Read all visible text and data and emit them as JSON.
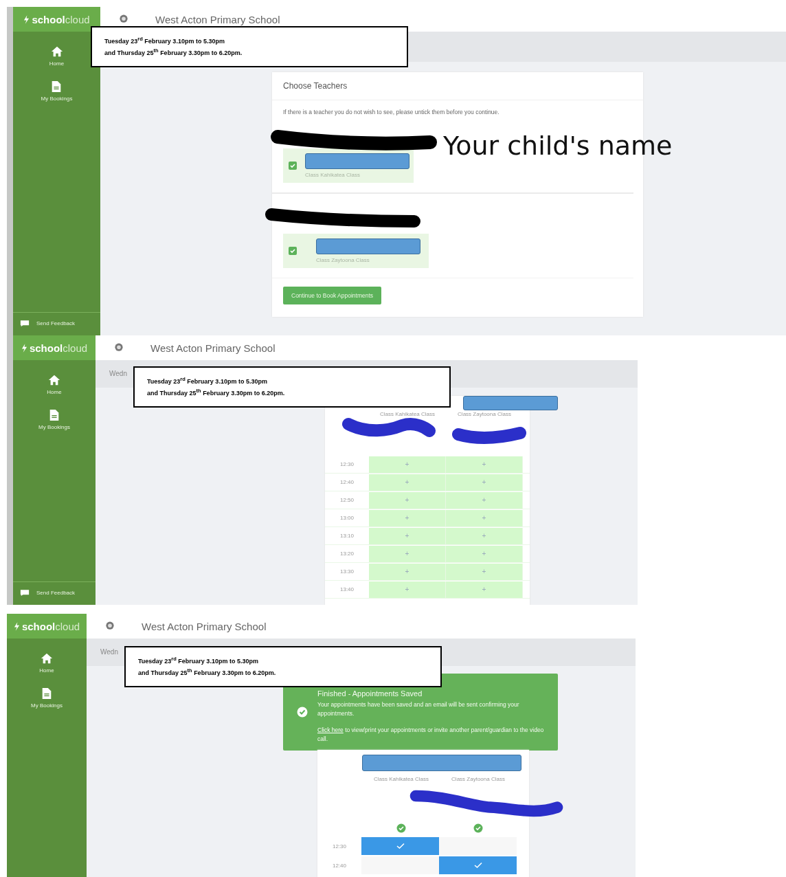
{
  "panels": [
    {
      "kind": "choose_teachers",
      "brand": {
        "bold": "school",
        "light": "cloud"
      },
      "school_name": "West Acton Primary School",
      "nav": [
        {
          "kind": "home",
          "label": "Home"
        },
        {
          "kind": "bookings",
          "label": "My Bookings"
        }
      ],
      "feedback": "Send Feedback",
      "note": [
        "Tuesday 23$^{rd}$ February 3.10pm to 5.30pm",
        "and Thursday 25$^{th}$ February 3.30pm to 6.20pm."
      ],
      "annotation": "Your child's name",
      "card": {
        "title": "Choose Teachers",
        "instruction": "If there is a teacher you do not wish to see, please untick them before you continue.",
        "teachers": [
          {
            "class": "Class Kahikatea Class",
            "checked": true
          },
          {
            "class": "Class Zaytoona Class",
            "checked": true
          }
        ],
        "button": "Continue to Book Appointments"
      }
    },
    {
      "kind": "slots",
      "brand": {
        "bold": "school",
        "light": "cloud"
      },
      "school_name": "West Acton Primary School",
      "nav": [
        {
          "kind": "home",
          "label": "Home"
        },
        {
          "kind": "bookings",
          "label": "My Bookings"
        }
      ],
      "feedback": "Send Feedback",
      "date_tab": "Wedn",
      "note": [
        "Tuesday 23$^{rd}$ February 3.10pm to 5.30pm",
        "and Thursday 25$^{th}$ February 3.30pm to 6.20pm."
      ],
      "columns": [
        "Class Kahikatea Class",
        "Class Zaytoona Class"
      ],
      "rows": [
        {
          "time": "12:30",
          "slots": [
            "+",
            "+"
          ]
        },
        {
          "time": "12:40",
          "slots": [
            "+",
            "+"
          ]
        },
        {
          "time": "12:50",
          "slots": [
            "+",
            "+"
          ]
        },
        {
          "time": "13:00",
          "slots": [
            "+",
            "+"
          ]
        },
        {
          "time": "13:10",
          "slots": [
            "+",
            "+"
          ]
        },
        {
          "time": "13:20",
          "slots": [
            "+",
            "+"
          ]
        },
        {
          "time": "13:30",
          "slots": [
            "+",
            "+"
          ]
        },
        {
          "time": "13:40",
          "slots": [
            "+",
            "+"
          ]
        }
      ]
    },
    {
      "kind": "saved",
      "brand": {
        "bold": "school",
        "light": "cloud"
      },
      "school_name": "West Acton Primary School",
      "nav": [
        {
          "kind": "home",
          "label": "Home"
        },
        {
          "kind": "bookings",
          "label": "My Bookings"
        }
      ],
      "date_tab": "Wedn",
      "note": [
        "Tuesday 23$^{rd}$ February 3.10pm to 5.30pm",
        "and Thursday 25$^{th}$ February 3.30pm to 6.20pm."
      ],
      "alert": {
        "title": "Finished - Appointments Saved",
        "text": "Your appointments have been saved and an email will be sent confirming your appointments.",
        "link": "Click here",
        "link_rest": "to view/print your appointments or invite another parent/guardian to the video call."
      },
      "columns": [
        "Class Kahikatea Class",
        "Class Zaytoona Class"
      ],
      "rows": [
        {
          "time": "12:30",
          "booked": [
            true,
            false
          ]
        },
        {
          "time": "12:40",
          "booked": [
            false,
            true
          ]
        }
      ]
    }
  ]
}
